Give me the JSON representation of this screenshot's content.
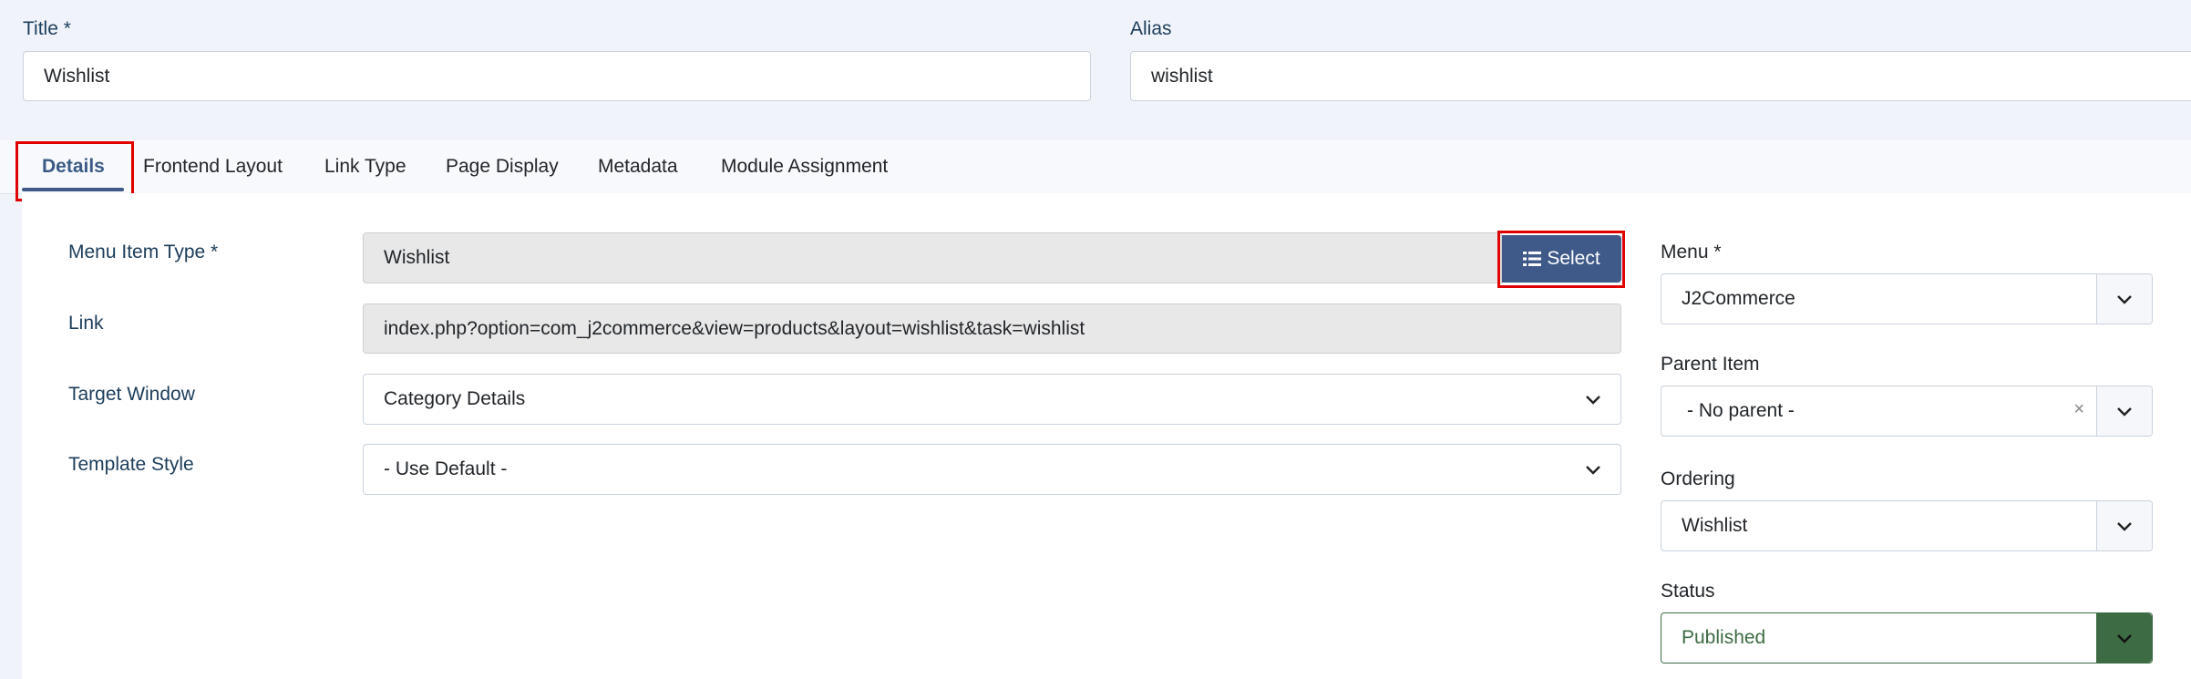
{
  "title": {
    "label": "Title *",
    "value": "Wishlist"
  },
  "alias": {
    "label": "Alias",
    "value": "wishlist"
  },
  "tabs": [
    {
      "label": "Details",
      "active": true
    },
    {
      "label": "Frontend Layout"
    },
    {
      "label": "Link Type"
    },
    {
      "label": "Page Display"
    },
    {
      "label": "Metadata"
    },
    {
      "label": "Module Assignment"
    }
  ],
  "details": {
    "menu_item_type": {
      "label": "Menu Item Type *",
      "value": "Wishlist",
      "button": "Select"
    },
    "link": {
      "label": "Link",
      "value": "index.php?option=com_j2commerce&view=products&layout=wishlist&task=wishlist"
    },
    "target_window": {
      "label": "Target Window",
      "value": "Category Details"
    },
    "template_style": {
      "label": "Template Style",
      "value": "- Use Default -"
    }
  },
  "sidebar": {
    "menu": {
      "label": "Menu *",
      "value": "J2Commerce"
    },
    "parent_item": {
      "label": "Parent Item",
      "value": "- No parent -",
      "clear": "×"
    },
    "ordering": {
      "label": "Ordering",
      "value": "Wishlist"
    },
    "status": {
      "label": "Status",
      "value": "Published"
    }
  },
  "colors": {
    "accent": "#3f5a88",
    "status_green": "#3d6b43",
    "highlight": "#e00000"
  },
  "icons": {
    "select": "list-icon",
    "dropdown": "chevron-down-icon",
    "clear": "close-icon"
  }
}
